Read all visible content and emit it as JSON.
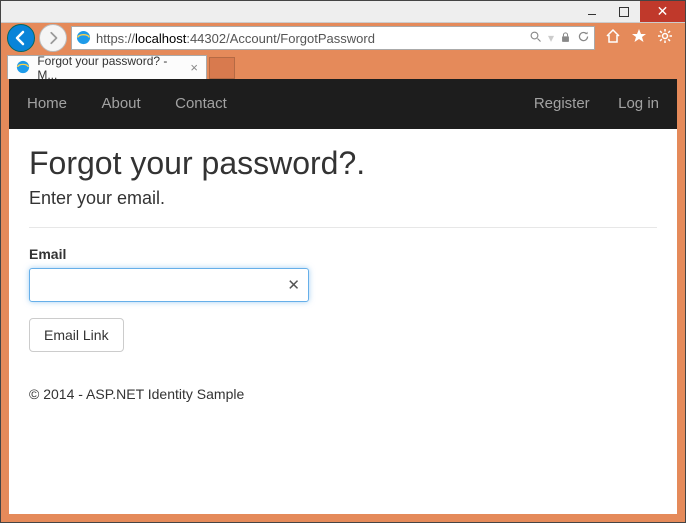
{
  "window": {
    "tab_title": "Forgot your password? - M..."
  },
  "address": {
    "scheme": "https://",
    "host": "localhost",
    "port_path": ":44302/Account/ForgotPassword"
  },
  "page_nav": {
    "left": [
      "Home",
      "About",
      "Contact"
    ],
    "right": [
      "Register",
      "Log in"
    ]
  },
  "content": {
    "heading": "Forgot your password?.",
    "subheading": "Enter your email.",
    "email_label": "Email",
    "email_value": "",
    "submit_label": "Email Link"
  },
  "footer": {
    "text": "© 2014 - ASP.NET Identity Sample"
  }
}
